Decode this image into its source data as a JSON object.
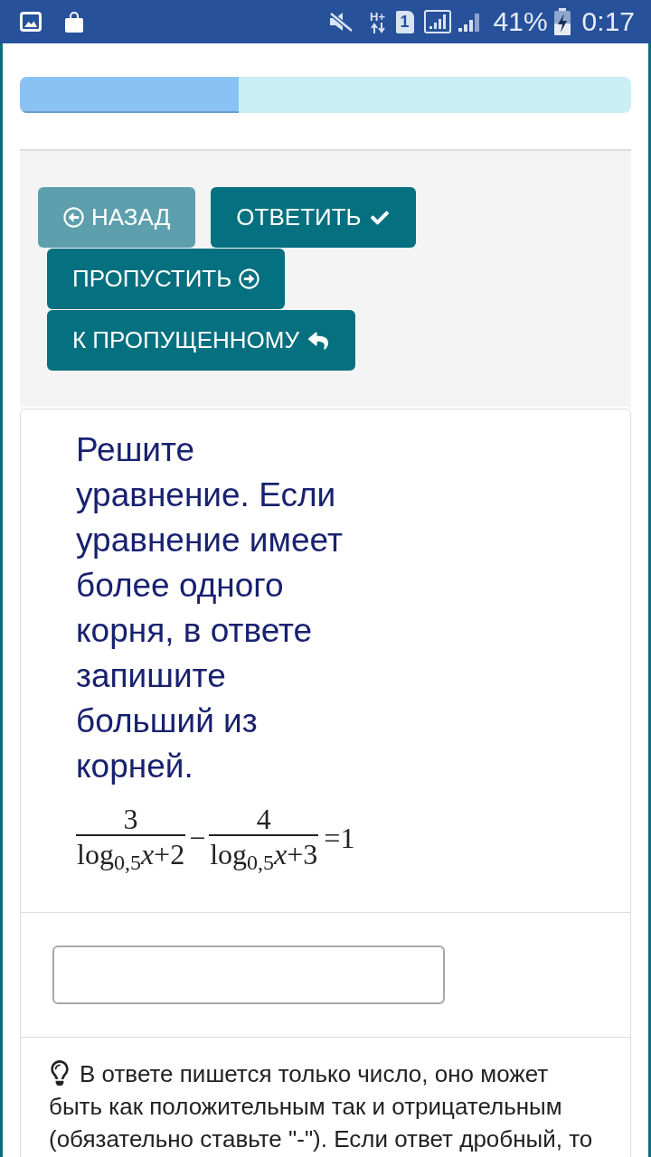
{
  "status_bar": {
    "network_type": "H+",
    "sim": "1",
    "battery": "41%",
    "time": "0:17"
  },
  "progress": {
    "level": 0.358
  },
  "buttons": [
    {
      "label": "НАЗАД",
      "kind": "back",
      "disabled": true
    },
    {
      "label": "ОТВЕТИТЬ",
      "kind": "answer",
      "disabled": false
    },
    {
      "label": "ПРОПУСТИТЬ",
      "kind": "skip",
      "disabled": false
    },
    {
      "label": "К ПРОПУЩЕННОМУ",
      "kind": "to-skipped",
      "disabled": false
    }
  ],
  "question": {
    "text": "Решите уравнение. Если уравнение имеет более одного корня, в ответе запишите больший из корней.",
    "equation": {
      "terms": [
        {
          "numerator": "3",
          "denominator": "log$_{0,5}$*x*+2"
        },
        {
          "numerator": "4",
          "denominator": "log$_{0,5}$*x*+3"
        }
      ],
      "operator": "−",
      "right_side": "=1"
    }
  },
  "hint": {
    "text": "В ответе пишется только число, оно может быть как положительным так и отрицательным (обязательно ставьте \"-\"). Если ответ дробный, то"
  }
}
